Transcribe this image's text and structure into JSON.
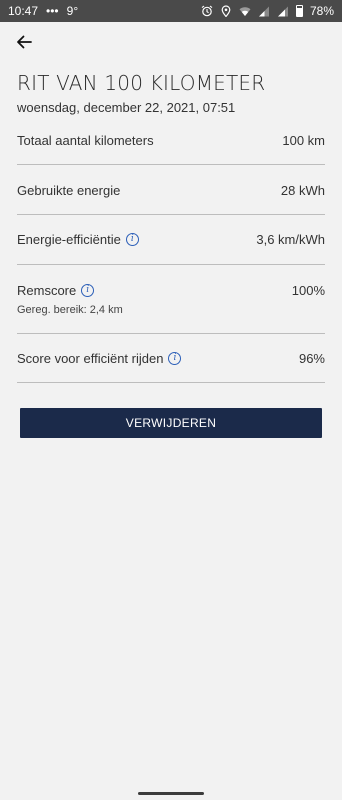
{
  "status_bar": {
    "time": "10:47",
    "dots": "•••",
    "temp": "9°",
    "battery_pct": "78%",
    "icons": [
      "alarm-icon",
      "location-icon",
      "wifi-icon",
      "signal-icon",
      "signal-icon",
      "battery-icon"
    ]
  },
  "header": {
    "back_icon": "arrow-left-icon",
    "title": "RIT VAN 100 KILOMETER",
    "subtitle": "woensdag, december 22, 2021, 07:51"
  },
  "stats": [
    {
      "label": "Totaal aantal kilometers",
      "value": "100 km",
      "info": false
    },
    {
      "label": "Gebruikte energie",
      "value": "28 kWh",
      "info": false
    },
    {
      "label": "Energie-efficiëntie",
      "value": "3,6 km/kWh",
      "info": true
    },
    {
      "label": "Remscore",
      "value": "100%",
      "info": true,
      "sub": "Gereg. bereik: 2,4 km"
    },
    {
      "label": "Score voor efficiënt rijden",
      "value": "96%",
      "info": true
    }
  ],
  "info_glyph": "i",
  "actions": {
    "delete_label": "VERWIJDEREN"
  },
  "colors": {
    "button": "#1b2a4a",
    "info": "#2c5fb8",
    "statusbar": "#4a4a4a",
    "background": "#f2f2f2"
  }
}
